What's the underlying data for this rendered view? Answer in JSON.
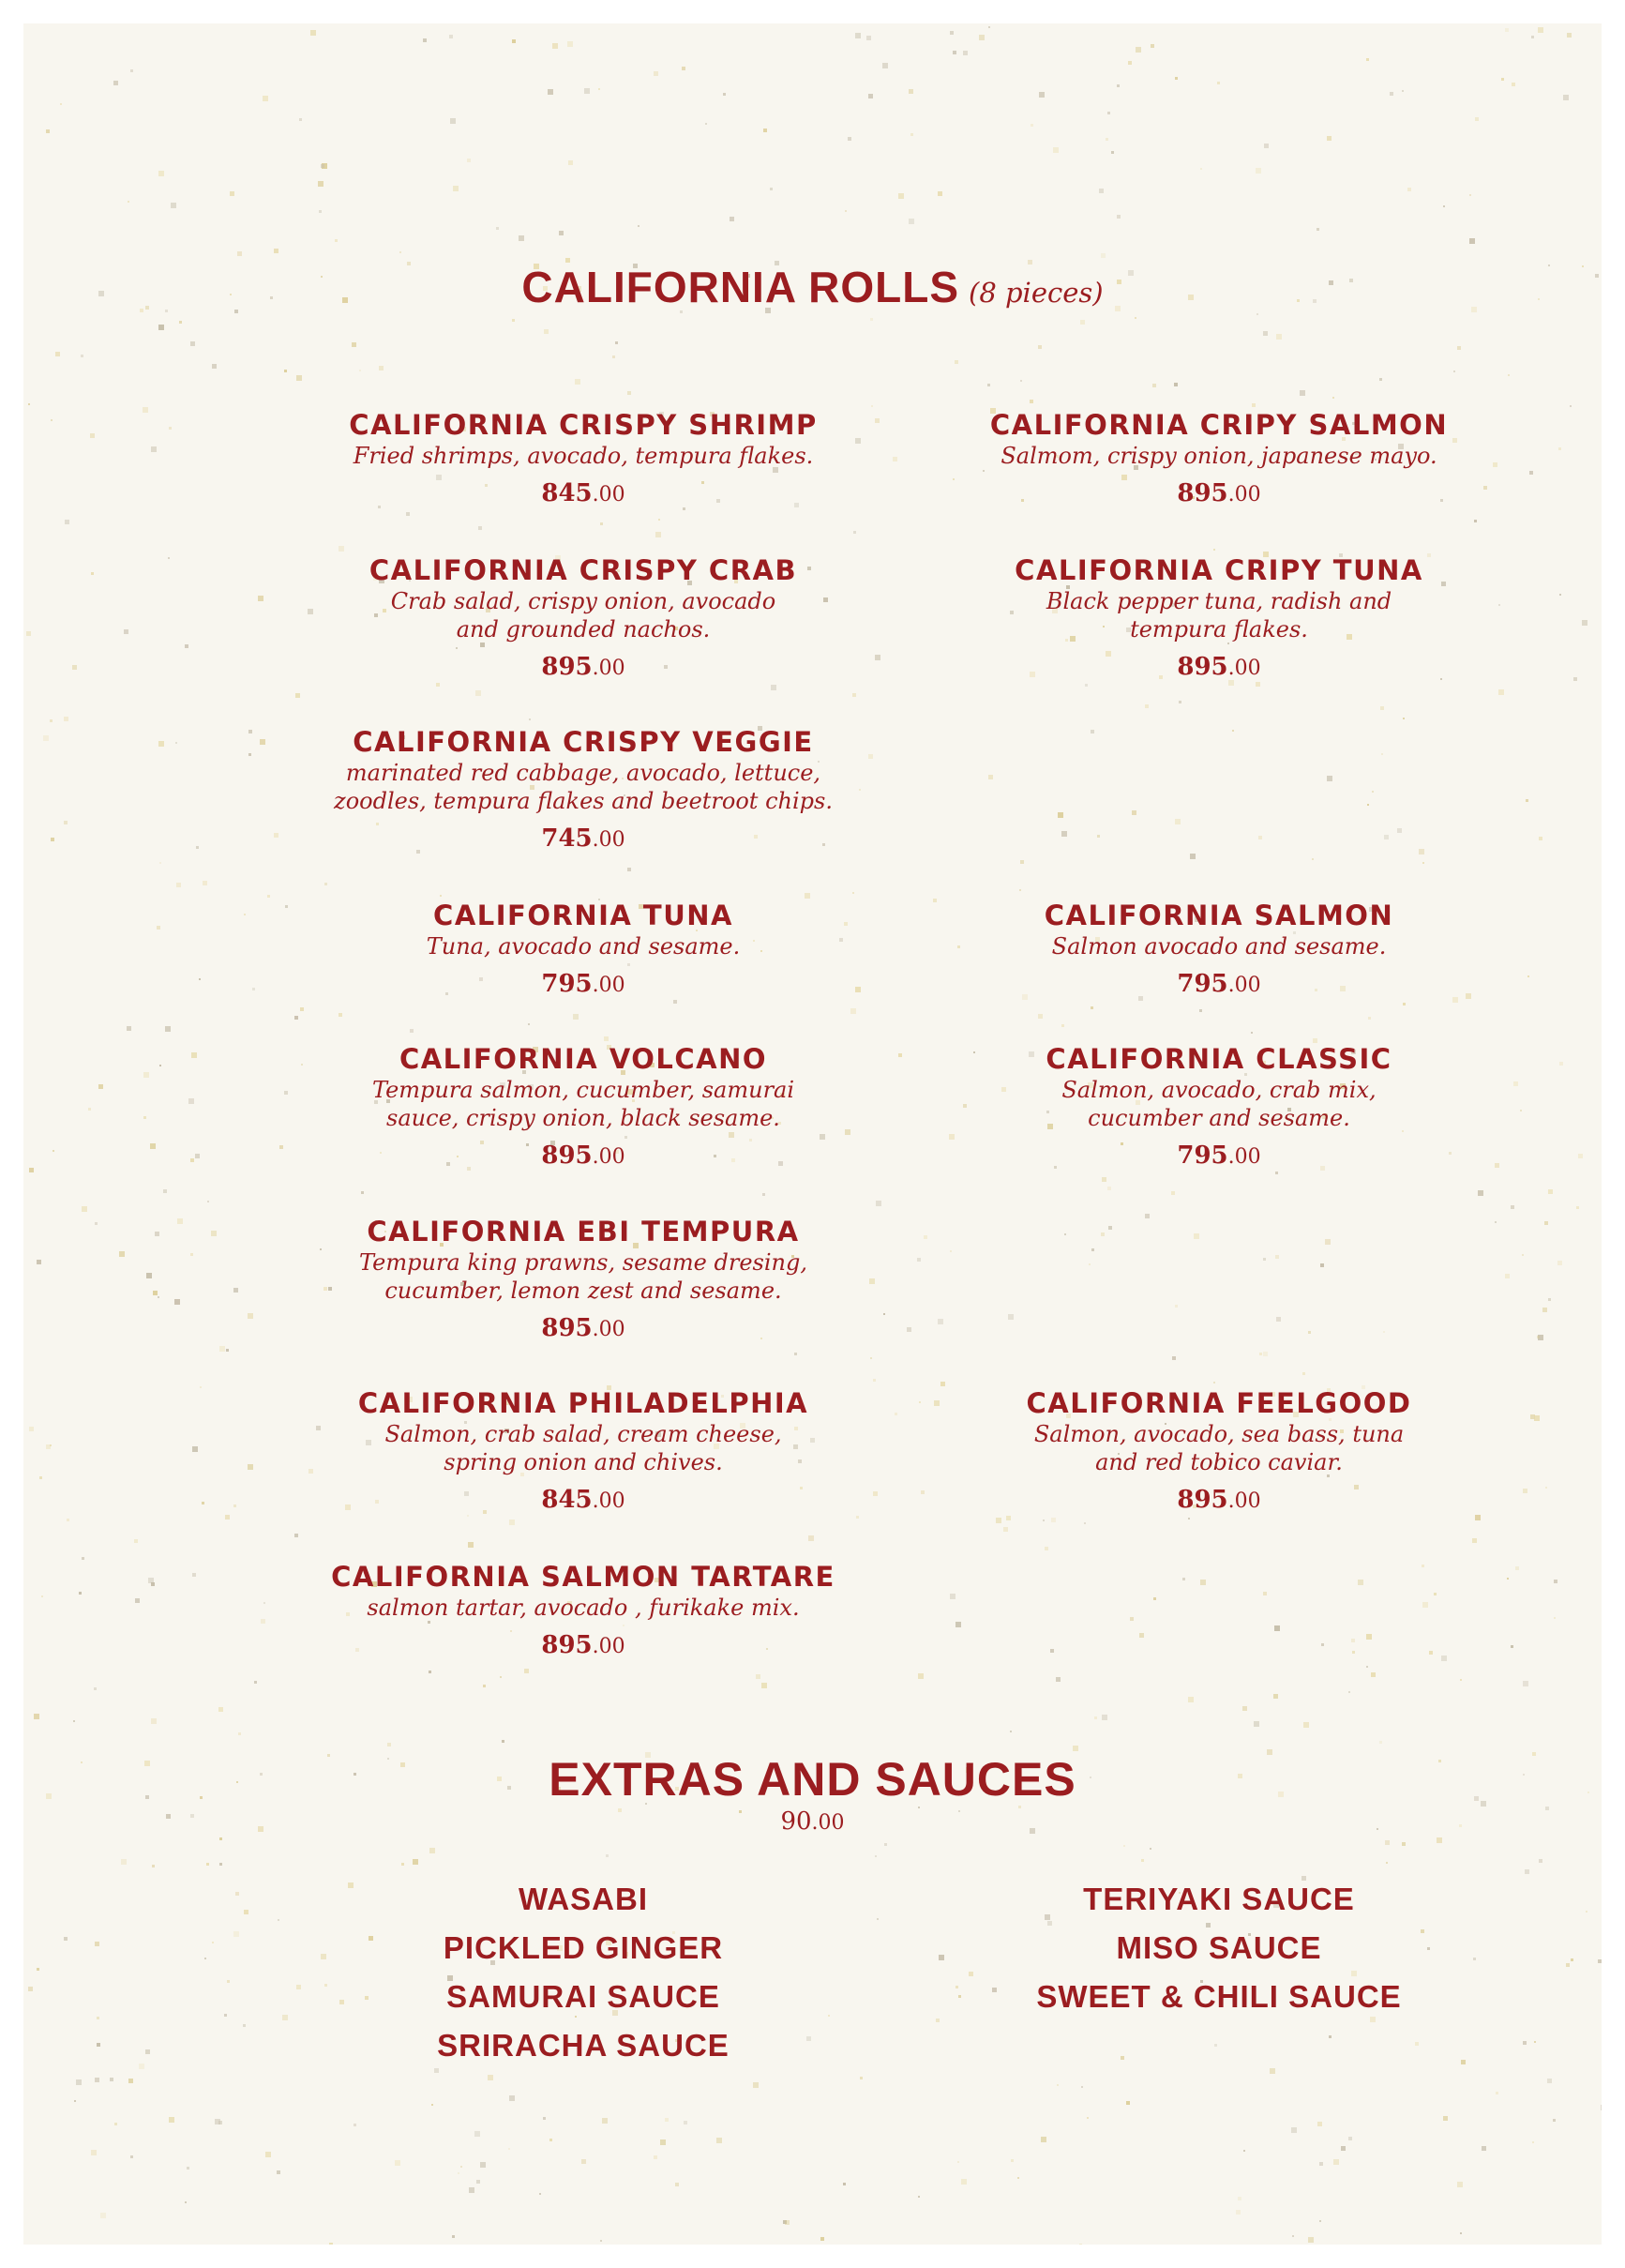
{
  "header": {
    "title": "CALIFORNIA ROLLS",
    "subtitle": "(8 pieces)"
  },
  "rolls_left": [
    {
      "name": "CALIFORNIA CRISPY SHRIMP",
      "desc": "Fried shrimps, avocado, tempura flakes.",
      "price": "845",
      "cents": ".00"
    },
    {
      "name": "CALIFORNIA CRISPY CRAB",
      "desc": "Crab salad, crispy onion, avocado\nand grounded nachos.",
      "price": "895",
      "cents": ".00"
    },
    {
      "name": "CALIFORNIA CRISPY VEGGIE",
      "desc": "marinated red cabbage, avocado, lettuce,\nzoodles, tempura flakes and beetroot chips.",
      "price": "745",
      "cents": ".00"
    },
    {
      "name": "CALIFORNIA TUNA",
      "desc": "Tuna, avocado and sesame.",
      "price": "795",
      "cents": ".00"
    },
    {
      "name": "CALIFORNIA VOLCANO",
      "desc": "Tempura salmon, cucumber, samurai\nsauce, crispy onion, black sesame.",
      "price": "895",
      "cents": ".00"
    },
    {
      "name": "CALIFORNIA EBI TEMPURA",
      "desc": "Tempura king prawns, sesame dresing,\ncucumber, lemon zest and sesame.",
      "price": "895",
      "cents": ".00"
    },
    {
      "name": "CALIFORNIA PHILADELPHIA",
      "desc": "Salmon, crab salad, cream cheese,\nspring onion and chives.",
      "price": "845",
      "cents": ".00"
    },
    {
      "name": "CALIFORNIA  SALMON TARTARE",
      "desc": "salmon tartar, avocado , furikake mix.",
      "price": "895",
      "cents": ".00"
    }
  ],
  "rolls_right": [
    {
      "name": "CALIFORNIA CRIPY SALMON",
      "desc": "Salmom, crispy onion, japanese mayo.",
      "price": "895",
      "cents": ".00"
    },
    {
      "name": "CALIFORNIA CRIPY TUNA",
      "desc": "Black pepper tuna, radish and\ntempura flakes.",
      "price": "895",
      "cents": ".00"
    },
    {
      "name": "CALIFORNIA SALMON",
      "desc": "Salmon avocado and sesame.",
      "price": "795",
      "cents": ".00"
    },
    {
      "name": "CALIFORNIA CLASSIC",
      "desc": "Salmon, avocado, crab mix,\ncucumber and sesame.",
      "price": "795",
      "cents": ".00"
    },
    {
      "name": "CALIFORNIA FEELGOOD",
      "desc": "Salmon, avocado, sea bass, tuna\nand red tobico caviar.",
      "price": "895",
      "cents": ".00"
    }
  ],
  "extras": {
    "title": "EXTRAS AND SAUCES",
    "price": "90",
    "cents": ".00",
    "left": [
      "WASABI",
      "PICKLED GINGER",
      "SAMURAI SAUCE",
      "SRIRACHA SAUCE"
    ],
    "right": [
      "TERIYAKI SAUCE",
      "MISO SAUCE",
      "SWEET & CHILI SAUCE"
    ]
  },
  "colors": {
    "accent": "#9b1d20",
    "paper": "#f8f6ef"
  }
}
